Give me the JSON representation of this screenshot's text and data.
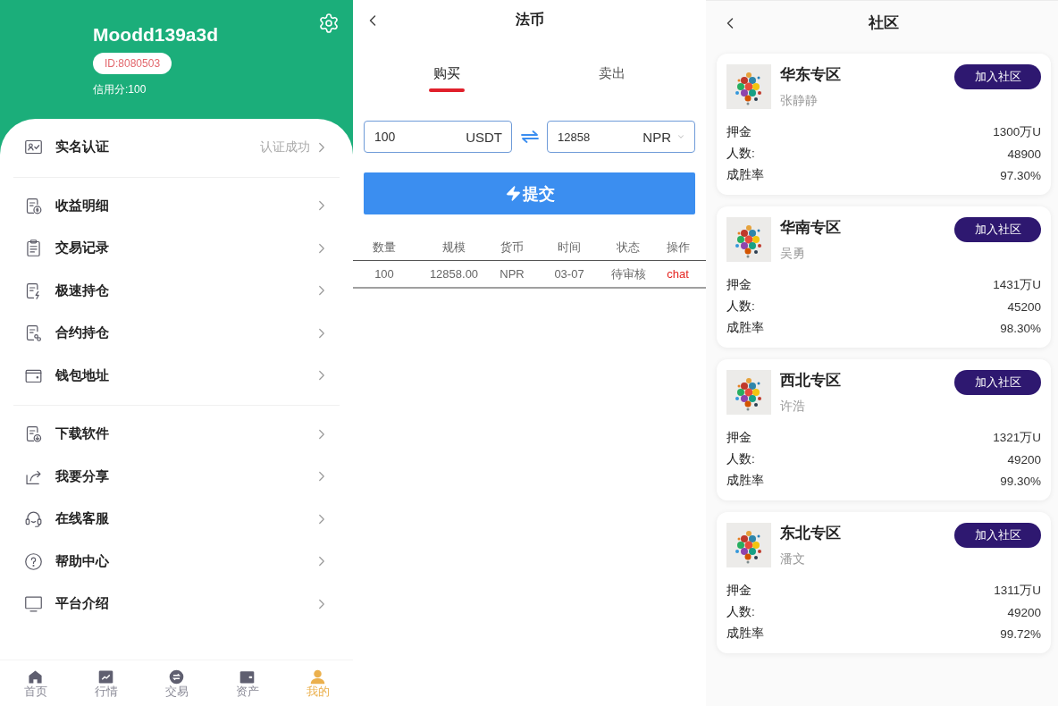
{
  "profile_screen": {
    "header": {
      "username": "Moodd139a3d",
      "user_id": "ID:8080503",
      "credit": "信用分:100"
    },
    "menu_groups": [
      {
        "items": [
          {
            "label": "实名认证",
            "value": "认证成功"
          }
        ]
      },
      {
        "items": [
          {
            "label": "收益明细"
          },
          {
            "label": "交易记录"
          },
          {
            "label": "极速持仓"
          },
          {
            "label": "合约持仓"
          },
          {
            "label": "钱包地址"
          }
        ]
      },
      {
        "items": [
          {
            "label": "下载软件"
          },
          {
            "label": "我要分享"
          },
          {
            "label": "在线客服"
          },
          {
            "label": "帮助中心"
          },
          {
            "label": "平台介绍"
          }
        ]
      }
    ],
    "bottom_nav": [
      {
        "label": "首页",
        "selected": false
      },
      {
        "label": "行情",
        "selected": false
      },
      {
        "label": "交易",
        "selected": false
      },
      {
        "label": "资产",
        "selected": false
      },
      {
        "label": "我的",
        "selected": true
      }
    ]
  },
  "fiat_screen": {
    "title": "法币",
    "tabs": [
      {
        "label": "购买",
        "selected": true
      },
      {
        "label": "卖出",
        "selected": false
      }
    ],
    "converter": {
      "from": {
        "value": "100",
        "unit": "USDT"
      },
      "to": {
        "value": "12858",
        "unit": "NPR"
      }
    },
    "submit_button": "提交",
    "table": {
      "columns": [
        "数量",
        "规模",
        "货币",
        "时间",
        "状态",
        "操作"
      ],
      "rows": [
        {
          "cells": [
            "100",
            "12858.00",
            "NPR",
            "03-07",
            "待审核"
          ],
          "action": "chat"
        }
      ]
    }
  },
  "community_screen": {
    "title": "社区",
    "communities": [
      {
        "name": "华东专区",
        "leader": "张静静",
        "join_button": "加入社区",
        "stats": [
          {
            "label": "押金",
            "value": "1300万U"
          },
          {
            "label": "人数:",
            "value": "48900"
          },
          {
            "label": "成胜率",
            "value": "97.30%"
          }
        ]
      },
      {
        "name": "华南专区",
        "leader": "吴勇",
        "join_button": "加入社区",
        "stats": [
          {
            "label": "押金",
            "value": "1431万U"
          },
          {
            "label": "人数:",
            "value": "45200"
          },
          {
            "label": "成胜率",
            "value": "98.30%"
          }
        ]
      },
      {
        "name": "西北专区",
        "leader": "许浩",
        "join_button": "加入社区",
        "stats": [
          {
            "label": "押金",
            "value": "1321万U"
          },
          {
            "label": "人数:",
            "value": "49200"
          },
          {
            "label": "成胜率",
            "value": "99.30%"
          }
        ]
      },
      {
        "name": "东北专区",
        "leader": "潘文",
        "join_button": "加入社区",
        "stats": [
          {
            "label": "押金",
            "value": "1311万U"
          },
          {
            "label": "人数:",
            "value": "49200"
          },
          {
            "label": "成胜率",
            "value": "99.72%"
          }
        ]
      }
    ]
  }
}
